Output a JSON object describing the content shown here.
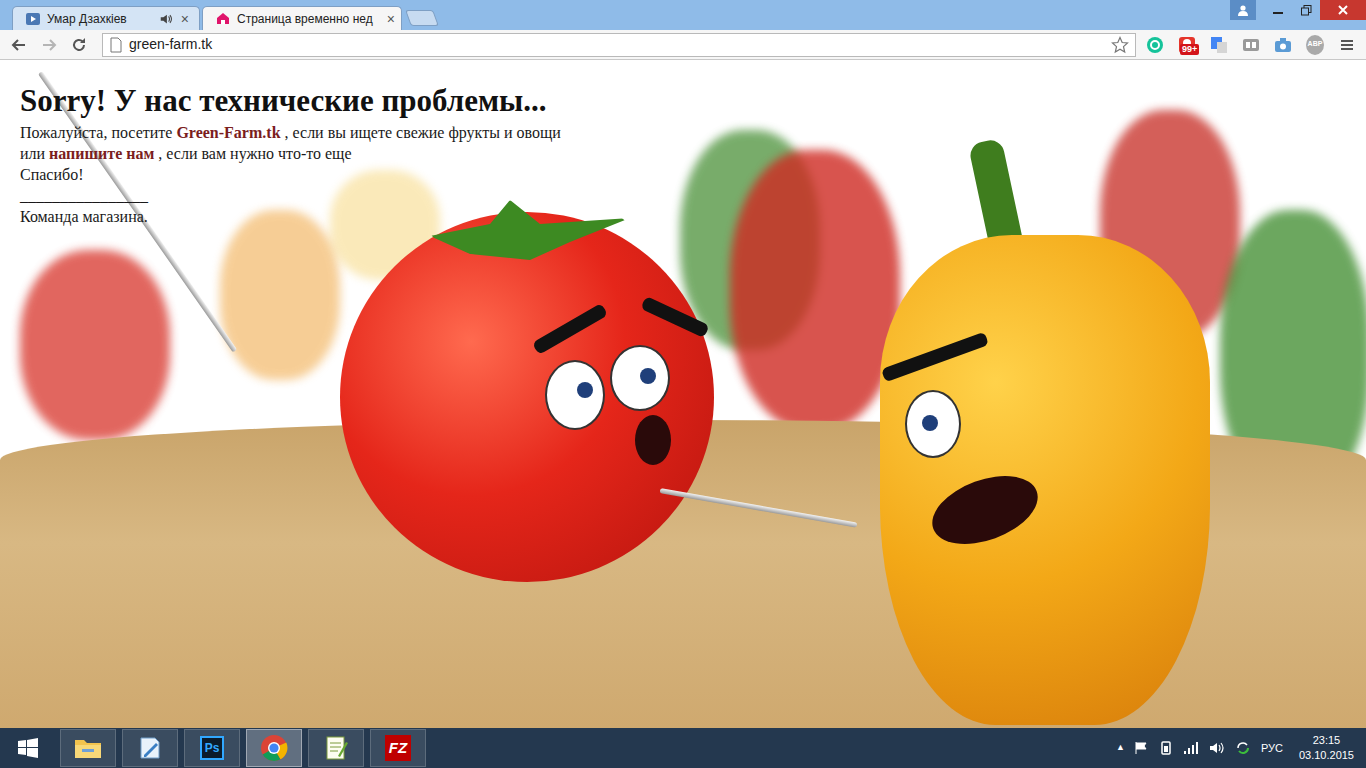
{
  "tabs": [
    {
      "label": "Умар Дзахкіев",
      "selected": false,
      "kind": "video",
      "audio_playing": true,
      "close": "×"
    },
    {
      "label": "Страница временно нед",
      "selected": true,
      "kind": "site",
      "audio_playing": false,
      "close": "×"
    }
  ],
  "toolbar": {
    "address": "green-farm.tk",
    "bookmarked": false,
    "extensions": [
      {
        "kind": "greencircle"
      },
      {
        "kind": "badged",
        "badge": "99+"
      },
      {
        "kind": "translate"
      },
      {
        "kind": "reader"
      },
      {
        "kind": "camera"
      },
      {
        "kind": "adblock",
        "label": "ABP"
      }
    ]
  },
  "page": {
    "heading": "Sorry! У нас технические проблемы...",
    "lines": [
      {
        "parts": [
          {
            "text": "Пожалуйста, посетите ",
            "link": false
          },
          {
            "text": "Green-Farm.tk",
            "link": true
          },
          {
            "text": " , если вы ищете свежие фрукты и овощи",
            "link": false
          }
        ]
      },
      {
        "parts": [
          {
            "text": "или ",
            "link": false
          },
          {
            "text": "напишите нам",
            "link": true
          },
          {
            "text": " , если вам нужно что-то еще",
            "link": false
          }
        ]
      },
      {
        "parts": [
          {
            "text": "Спасибо!",
            "link": false
          }
        ]
      },
      {
        "parts": [
          {
            "text": "________________",
            "link": false
          }
        ]
      },
      {
        "parts": [
          {
            "text": "Команда магазина.",
            "link": false
          }
        ]
      }
    ]
  },
  "taskbar": {
    "apps": [
      {
        "kind": "explorer",
        "selected": false
      },
      {
        "kind": "notes",
        "selected": false
      },
      {
        "kind": "photoshop",
        "selected": false,
        "icon_text": "Ps"
      },
      {
        "kind": "chrome",
        "selected": true
      },
      {
        "kind": "notepad",
        "selected": false
      },
      {
        "kind": "filezilla",
        "selected": false,
        "icon_text": "FZ"
      }
    ],
    "tray": {
      "arrow": "▲",
      "language": "РУС",
      "time": "23:15",
      "date": "03.10.2015"
    }
  }
}
